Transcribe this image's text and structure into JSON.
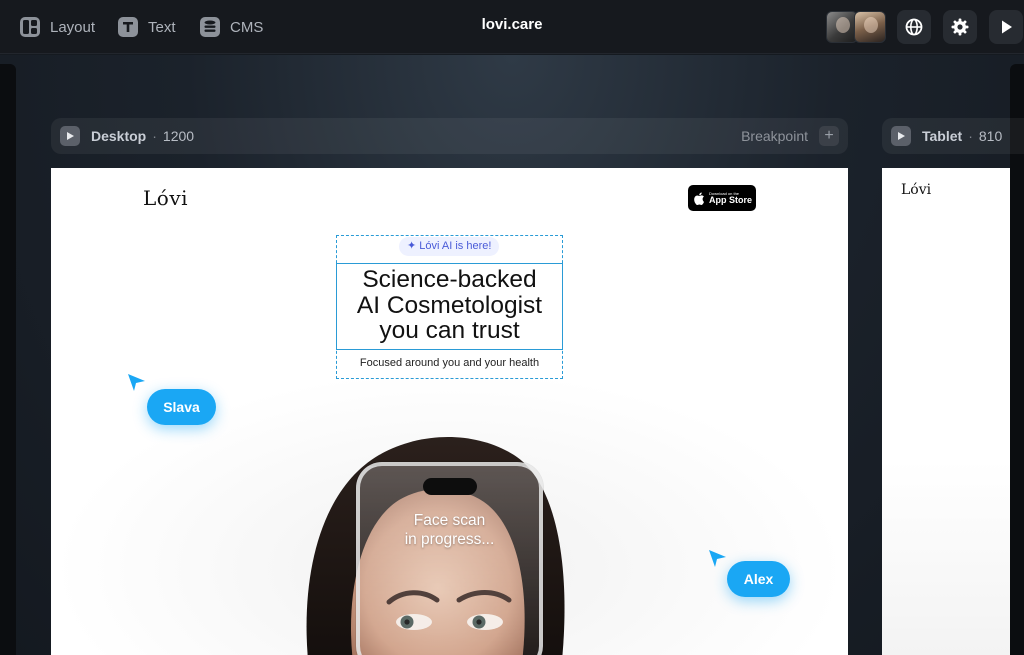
{
  "toolbar": {
    "tools": [
      {
        "label": "Layout",
        "icon": "layout-icon"
      },
      {
        "label": "Text",
        "icon": "text-icon"
      },
      {
        "label": "CMS",
        "icon": "database-icon"
      }
    ],
    "site_title": "lovi.care",
    "actions": [
      {
        "icon": "globe-icon"
      },
      {
        "icon": "gear-icon"
      },
      {
        "icon": "play-icon"
      }
    ]
  },
  "frames": {
    "desktop": {
      "name": "Desktop",
      "width": "1200",
      "breakpoint_label": "Breakpoint",
      "add_label": "+"
    },
    "tablet": {
      "name": "Tablet",
      "width": "810"
    }
  },
  "page": {
    "logo": "Lóvi",
    "app_store": {
      "small": "Download on the",
      "big": "App Store"
    },
    "badge": "✦ Lóvi AI is here!",
    "headline_lines": [
      "Science-backed",
      "AI Cosmetologist",
      "you can trust"
    ],
    "subline": "Focused around you and your health",
    "scan_lines": [
      "Face scan",
      "in progress..."
    ]
  },
  "cursors": [
    {
      "name": "Slava",
      "color": "#1aa7f4"
    },
    {
      "name": "Alex",
      "color": "#1aa7f4"
    }
  ],
  "colors": {
    "accent": "#1aa7f4",
    "selection": "#2a9bd6",
    "toolbar_bg": "#16191e"
  }
}
